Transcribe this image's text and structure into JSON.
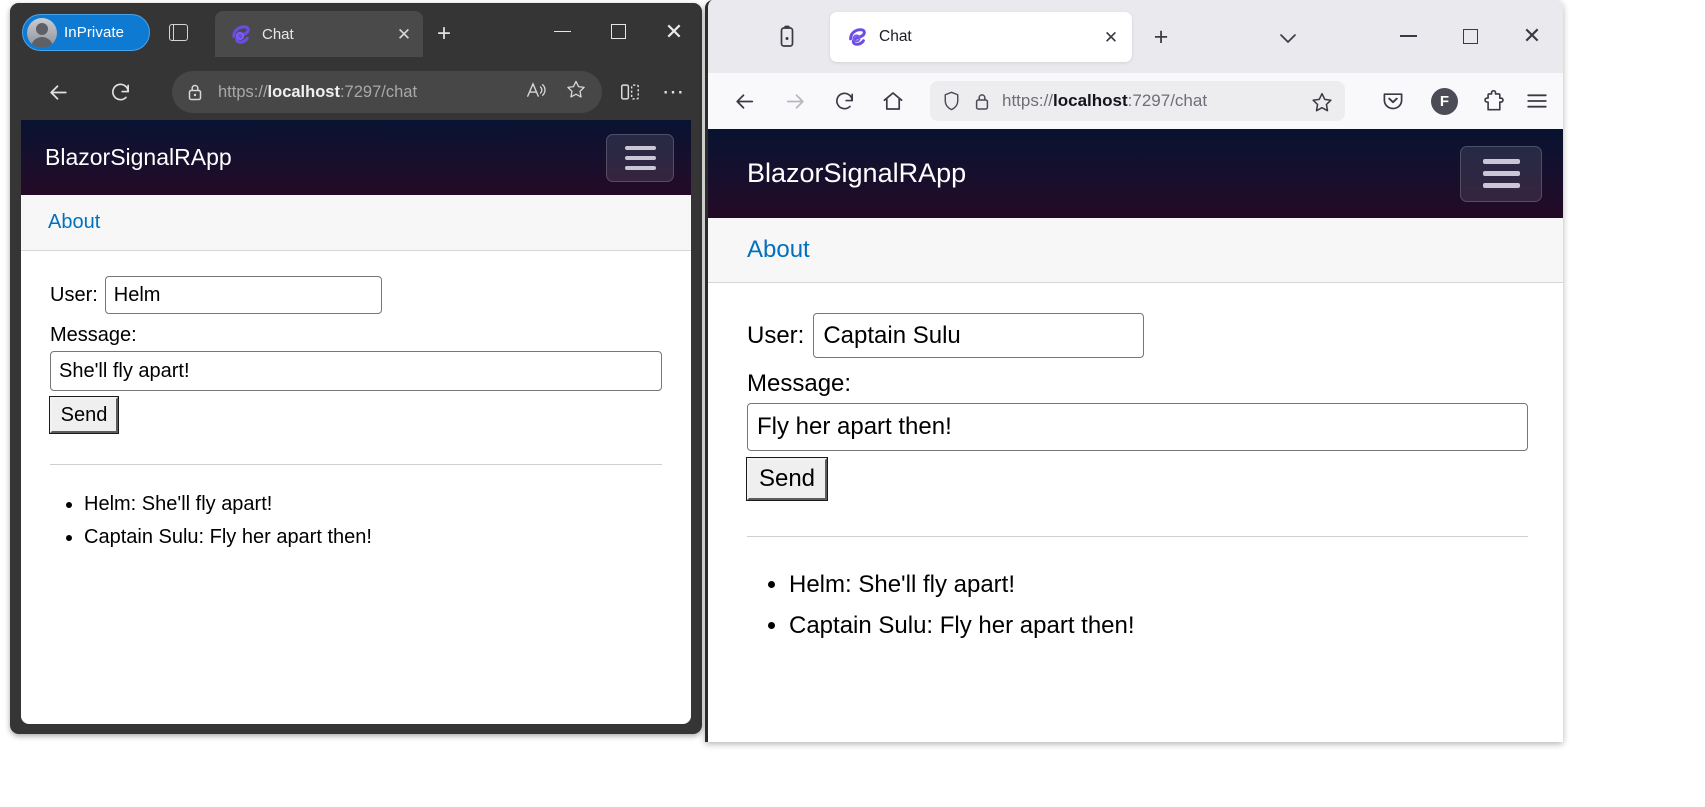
{
  "edge": {
    "window_name": "Microsoft Edge InPrivate",
    "profile_label": "InPrivate",
    "tab": {
      "title": "Chat",
      "favicon": "blazor-favicon",
      "close_glyph": "✕"
    },
    "new_tab_glyph": "+",
    "window_controls": {
      "minimize": "–",
      "maximize": "□",
      "close": "✕"
    },
    "toolbar": {
      "back_glyph": "←",
      "reload_glyph": "↻",
      "lock_icon": "lock-icon",
      "url": "https://localhost:7297/chat",
      "url_scheme": "https://",
      "url_host": "localhost",
      "url_rest": ":7297/chat",
      "read_aloud_glyph": "A",
      "favorite_glyph": "☆",
      "split_screen_icon": "split-screen-icon",
      "more_glyph": "⋯"
    },
    "page": {
      "brand": "BlazorSignalRApp",
      "about_link": "About",
      "user_label": "User:",
      "user_value": "Helm",
      "message_label": "Message:",
      "message_value": "She'll fly apart!",
      "send_label": "Send",
      "messages": [
        "Helm: She'll fly apart!",
        "Captain Sulu: Fly her apart then!"
      ]
    }
  },
  "firefox": {
    "window_name": "Mozilla Firefox",
    "list_all_tabs_icon": "list-all-tabs-icon",
    "tab": {
      "title": "Chat",
      "favicon": "blazor-favicon",
      "close_glyph": "✕"
    },
    "new_tab_glyph": "+",
    "tab_dropdown_glyph": "∨",
    "window_controls": {
      "minimize": "–",
      "maximize": "□",
      "close": "✕"
    },
    "toolbar": {
      "back_glyph": "←",
      "forward_glyph": "→",
      "reload_glyph": "↻",
      "home_icon": "home-icon",
      "shield_icon": "shield-icon",
      "lock_icon": "lock-icon",
      "url": "https://localhost:7297/chat",
      "url_scheme": "https://",
      "url_host": "localhost",
      "url_rest": ":7297/chat",
      "bookmark_glyph": "☆",
      "pocket_icon": "pocket-icon",
      "account_initial": "F",
      "extensions_icon": "extensions-puzzle-icon",
      "app_menu_icon": "hamburger-menu-icon"
    },
    "page": {
      "brand": "BlazorSignalRApp",
      "about_link": "About",
      "user_label": "User:",
      "user_value": "Captain Sulu",
      "message_label": "Message:",
      "message_value": "Fly her apart then!",
      "send_label": "Send",
      "messages": [
        "Helm: She'll fly apart!",
        "Captain Sulu: Fly her apart then!"
      ]
    }
  },
  "colors": {
    "edge_chrome": "#353535",
    "firefox_chrome": "#e9e9ee",
    "blazor_header_start": "#081331",
    "blazor_header_end": "#240a26",
    "link_blue": "#0071c1",
    "inprivate_blue": "#0f7ad1"
  }
}
